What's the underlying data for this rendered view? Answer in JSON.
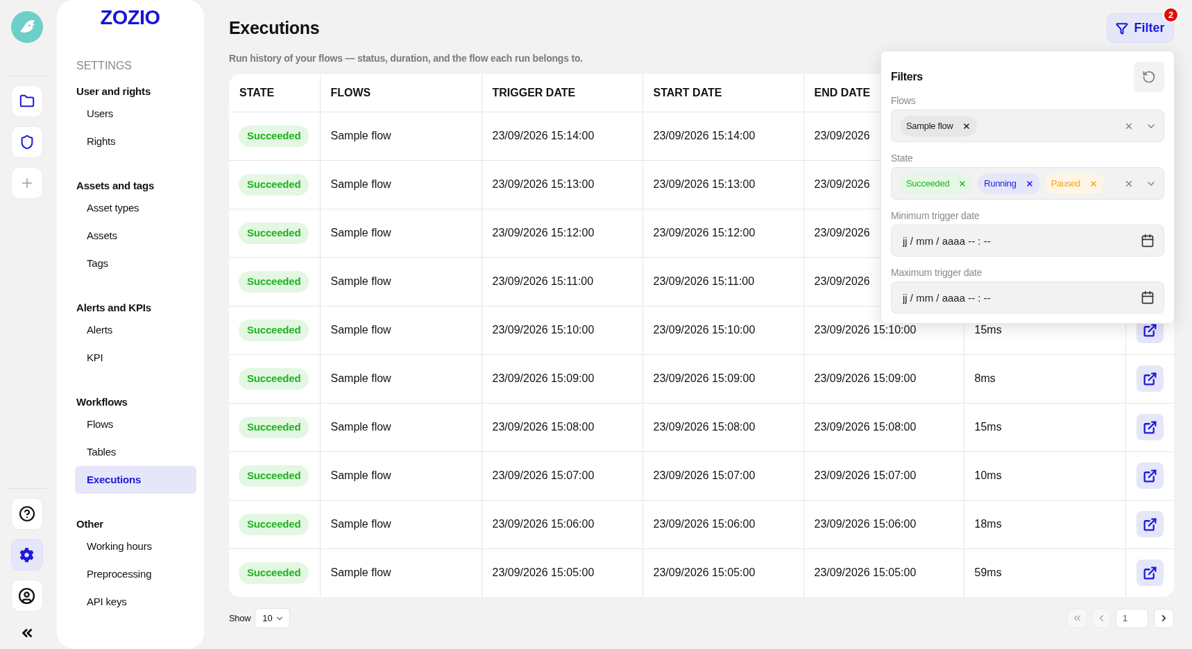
{
  "rail": {
    "top_items": [
      {
        "kind": "folder",
        "selected": false
      },
      {
        "kind": "shield",
        "selected": false
      },
      {
        "kind": "add",
        "selected": false
      }
    ],
    "bottom_items": [
      {
        "kind": "help",
        "selected": false
      },
      {
        "kind": "settings",
        "selected": true
      },
      {
        "kind": "profile",
        "selected": false
      }
    ]
  },
  "sidebar": {
    "logo": "ZOZIO",
    "heading": "SETTINGS",
    "sections": [
      {
        "title": "User and rights",
        "items": [
          {
            "label": "Users",
            "selected": false
          },
          {
            "label": "Rights",
            "selected": false
          }
        ]
      },
      {
        "title": "Assets and tags",
        "items": [
          {
            "label": "Asset types",
            "selected": false
          },
          {
            "label": "Assets",
            "selected": false
          },
          {
            "label": "Tags",
            "selected": false
          }
        ]
      },
      {
        "title": "Alerts and KPIs",
        "items": [
          {
            "label": "Alerts",
            "selected": false
          },
          {
            "label": "KPI",
            "selected": false
          }
        ]
      },
      {
        "title": "Workflows",
        "items": [
          {
            "label": "Flows",
            "selected": false
          },
          {
            "label": "Tables",
            "selected": false
          },
          {
            "label": "Executions",
            "selected": true
          }
        ]
      },
      {
        "title": "Other",
        "items": [
          {
            "label": "Working hours",
            "selected": false
          },
          {
            "label": "Preprocessing",
            "selected": false
          },
          {
            "label": "API keys",
            "selected": false
          }
        ]
      }
    ]
  },
  "header": {
    "title": "Executions",
    "subtitle": "Run history of your flows — status, duration, and the flow each run belongs to.",
    "filter_button": {
      "label": "Filter",
      "badge": "2"
    }
  },
  "filters_panel": {
    "title": "Filters",
    "fields": [
      {
        "kind": "multiselect",
        "label": "Flows",
        "chips": [
          {
            "label": "Sample flow",
            "color": "#222222"
          }
        ]
      },
      {
        "kind": "multiselect",
        "label": "State",
        "chips": [
          {
            "label": "Succeeded",
            "color": "#1fb41f"
          },
          {
            "label": "Running",
            "color": "#1a1adb"
          },
          {
            "label": "Paused",
            "color": "#f5a51c"
          }
        ]
      },
      {
        "kind": "datetime",
        "label": "Minimum trigger date",
        "placeholder": "jj / mm / aaaa -- : --"
      },
      {
        "kind": "datetime",
        "label": "Maximum trigger date",
        "placeholder": "jj / mm / aaaa -- : --"
      }
    ]
  },
  "table": {
    "columns": [
      "STATE",
      "FLOWS",
      "TRIGGER DATE",
      "START DATE",
      "END DATE"
    ],
    "rows": [
      {
        "state": {
          "label": "Succeeded",
          "kind": "success"
        },
        "flow": "Sample flow",
        "trigger_date": "23/09/2026 15:14:00",
        "start_date": "23/09/2026 15:14:00",
        "end_date": "23/09/2026"
      },
      {
        "state": {
          "label": "Succeeded",
          "kind": "success"
        },
        "flow": "Sample flow",
        "trigger_date": "23/09/2026 15:13:00",
        "start_date": "23/09/2026 15:13:00",
        "end_date": "23/09/2026"
      },
      {
        "state": {
          "label": "Succeeded",
          "kind": "success"
        },
        "flow": "Sample flow",
        "trigger_date": "23/09/2026 15:12:00",
        "start_date": "23/09/2026 15:12:00",
        "end_date": "23/09/2026"
      },
      {
        "state": {
          "label": "Succeeded",
          "kind": "success"
        },
        "flow": "Sample flow",
        "trigger_date": "23/09/2026 15:11:00",
        "start_date": "23/09/2026 15:11:00",
        "end_date": "23/09/2026"
      },
      {
        "state": {
          "label": "Succeeded",
          "kind": "success"
        },
        "flow": "Sample flow",
        "trigger_date": "23/09/2026 15:10:00",
        "start_date": "23/09/2026 15:10:00",
        "end_date": "23/09/2026 15:10:00",
        "duration": "15ms",
        "open_button": true
      },
      {
        "state": {
          "label": "Succeeded",
          "kind": "success"
        },
        "flow": "Sample flow",
        "trigger_date": "23/09/2026 15:09:00",
        "start_date": "23/09/2026 15:09:00",
        "end_date": "23/09/2026 15:09:00",
        "duration": "8ms",
        "open_button": true
      },
      {
        "state": {
          "label": "Succeeded",
          "kind": "success"
        },
        "flow": "Sample flow",
        "trigger_date": "23/09/2026 15:08:00",
        "start_date": "23/09/2026 15:08:00",
        "end_date": "23/09/2026 15:08:00",
        "duration": "15ms",
        "open_button": true
      },
      {
        "state": {
          "label": "Succeeded",
          "kind": "success"
        },
        "flow": "Sample flow",
        "trigger_date": "23/09/2026 15:07:00",
        "start_date": "23/09/2026 15:07:00",
        "end_date": "23/09/2026 15:07:00",
        "duration": "10ms",
        "open_button": true
      },
      {
        "state": {
          "label": "Succeeded",
          "kind": "success"
        },
        "flow": "Sample flow",
        "trigger_date": "23/09/2026 15:06:00",
        "start_date": "23/09/2026 15:06:00",
        "end_date": "23/09/2026 15:06:00",
        "duration": "18ms",
        "open_button": true
      },
      {
        "state": {
          "label": "Succeeded",
          "kind": "success"
        },
        "flow": "Sample flow",
        "trigger_date": "23/09/2026 15:05:00",
        "start_date": "23/09/2026 15:05:00",
        "end_date": "23/09/2026 15:05:00",
        "duration": "59ms",
        "open_button": true
      }
    ]
  },
  "pagination": {
    "label": "Show",
    "page_size": "10",
    "buttons_before": [
      {
        "kind": "first",
        "disabled": true
      },
      {
        "kind": "previous",
        "disabled": true
      }
    ],
    "page": "1",
    "buttons_after": [
      {
        "kind": "next",
        "disabled": false
      }
    ]
  }
}
